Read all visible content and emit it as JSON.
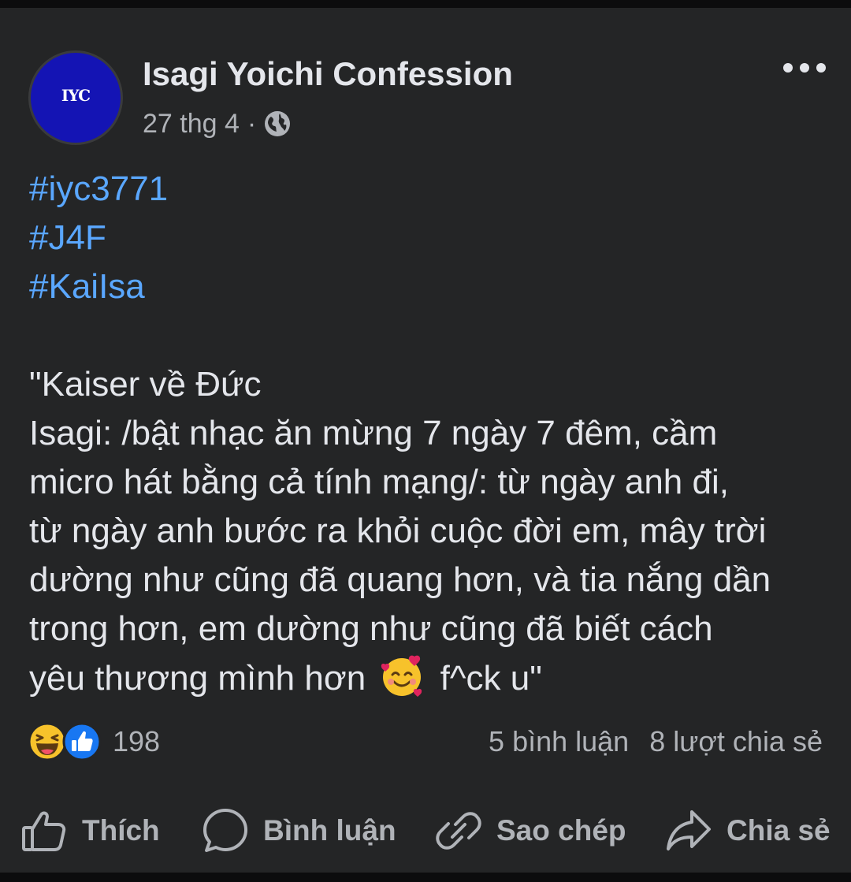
{
  "post": {
    "page_name": "Isagi Yoichi Confession",
    "avatar_text": "IYC",
    "date": "27 thg 4",
    "separator": "·",
    "privacy_icon": "globe-icon",
    "more_icon": "more-horizontal-icon",
    "hashtags": [
      "#iyc3771",
      "#J4F",
      "#KaiIsa"
    ],
    "lines": [
      "\"Kaiser về Đức",
      "Isagi: /bật nhạc ăn mừng 7 ngày 7 đêm, cầm",
      "micro hát bằng cả tính mạng/: từ ngày anh đi,",
      "từ ngày anh bước ra khỏi cuộc đời em, mây trời",
      "dường như cũng đã quang hơn, và tia nắng dần",
      "trong hơn, em dường như cũng đã biết cách"
    ],
    "last_line_before_emoji": "yêu thương mình hơn",
    "last_line_emoji": "smiling-face-with-hearts-emoji",
    "last_line_after_emoji": "f^ck u\""
  },
  "reactions": {
    "icons": [
      "haha-icon",
      "like-icon"
    ],
    "count": "198"
  },
  "stats": {
    "comments": "5 bình luận",
    "shares": "8 lượt chia sẻ"
  },
  "actions": {
    "like": "Thích",
    "comment": "Bình luận",
    "copy": "Sao chép",
    "share": "Chia sẻ"
  },
  "colors": {
    "background": "#242526",
    "text": "#e4e6eb",
    "secondary_text": "#b0b3b8",
    "hashtag": "#5aa7ff",
    "avatar": "#1414b4",
    "like_blue": "#1877f2"
  }
}
